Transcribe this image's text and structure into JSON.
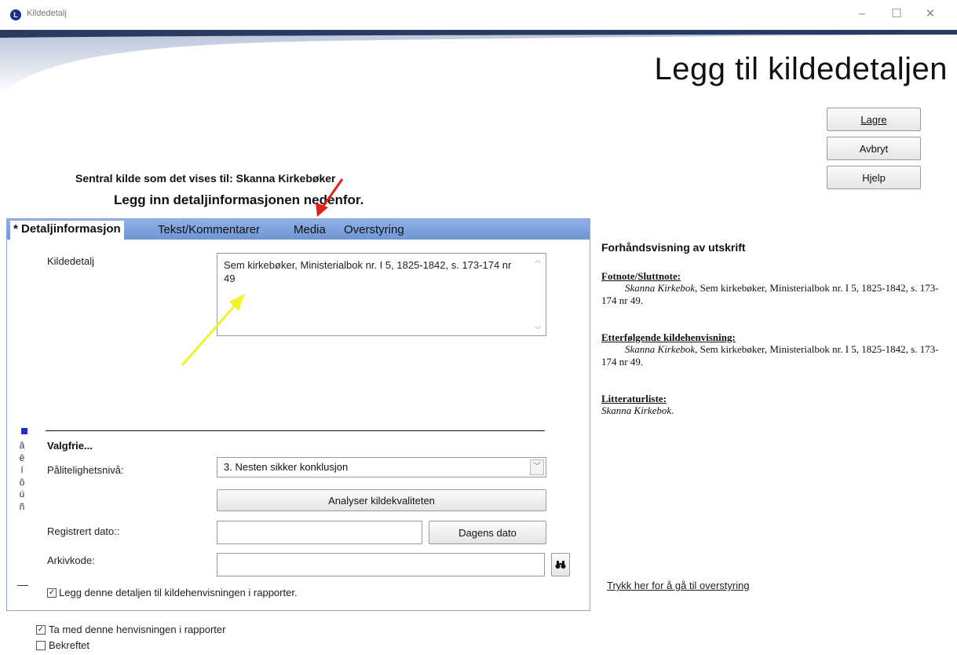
{
  "window": {
    "title": "Kildedetalj",
    "controls": {
      "minimize": "–",
      "maximize": "☐",
      "close": "✕"
    }
  },
  "banner": {
    "title": "Legg til kildedetaljen"
  },
  "actions": {
    "save_label": "Lagre",
    "cancel_label": "Avbryt",
    "help_label": "Hjelp"
  },
  "header": {
    "central_source": "Sentral kilde som det vises til:  Skanna Kirkebøker",
    "instruction": "Legg inn detaljinformasjonen nedenfor."
  },
  "tabs": [
    {
      "label": "* Detaljinformasjon",
      "active": true
    },
    {
      "label": "Tekst/Kommentarer",
      "active": false
    },
    {
      "label": "Media",
      "active": false
    },
    {
      "label": "Overstyring",
      "active": false
    }
  ],
  "form": {
    "detail_label": "Kildedetalj",
    "detail_value": "Sem kirkebøker, Ministerialbok nr. I 5, 1825-1842, s. 173-174 nr 49",
    "optional_heading": "Valgfrie...",
    "reliability_label": "Pålitelighetsnivå:",
    "reliability_value": "3.  Nesten sikker konklusjon",
    "analyze_button": "Analyser kildekvaliteten",
    "registered_date_label": "Registrert dato::",
    "registered_date_value": "",
    "today_button": "Dagens dato",
    "archive_code_label": "Arkivkode:",
    "archive_code_value": "",
    "include_detail_label": "Legg denne detaljen til kildehenvisningen i rapporter.",
    "include_detail_checked": true
  },
  "special_chars": [
    "â",
    "ê",
    "í",
    "ô",
    "ú",
    "ñ"
  ],
  "bottom": {
    "include_reference_label": "Ta med denne henvisningen i rapporter",
    "include_reference_checked": true,
    "confirmed_label": "Bekreftet",
    "confirmed_checked": false
  },
  "preview": {
    "title": "Forhåndsvisning av utskrift",
    "footnote_heading": "Fotnote/Sluttnote:",
    "footnote_source": "Skanna Kirkebok,",
    "footnote_text": " Sem kirkebøker, Ministerialbok nr. I 5, 1825-1842, s. 173-174 nr 49.",
    "subsequent_heading": "Etterfølgende kildehenvisning:",
    "subsequent_source": "Skanna Kirkebok,",
    "subsequent_text": " Sem kirkebøker, Ministerialbok nr. I 5, 1825-1842, s. 173-174 nr 49.",
    "bibliography_heading": "Litteraturliste:",
    "bibliography_text": "Skanna Kirkebok."
  },
  "override_link": "Trykk her for å gå til overstyring",
  "colors": {
    "tab_bar": "#7c9fdc",
    "banner_dark": "#2b3a60",
    "arrow_red": "#e0201c",
    "arrow_yellow": "#f2f22a"
  }
}
